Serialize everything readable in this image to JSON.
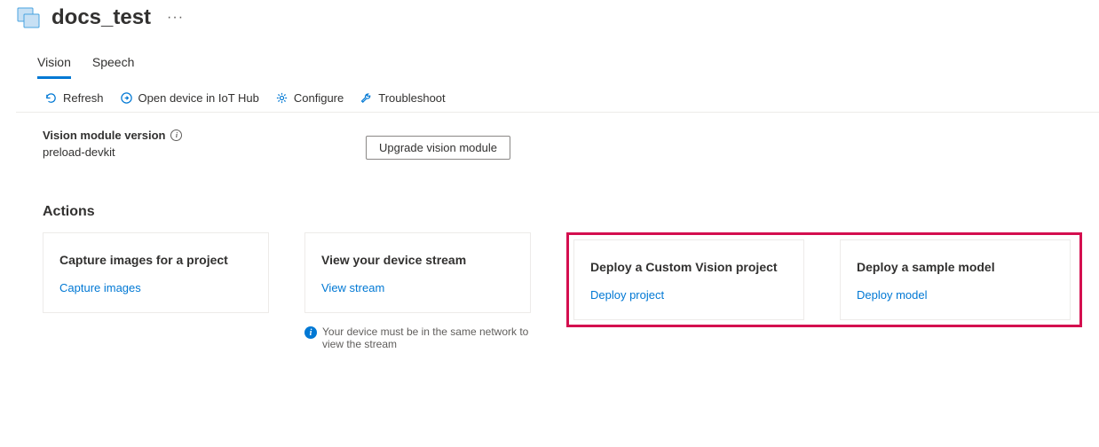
{
  "header": {
    "title": "docs_test",
    "more": "···"
  },
  "tabs": [
    {
      "id": "vision",
      "label": "Vision",
      "active": true
    },
    {
      "id": "speech",
      "label": "Speech",
      "active": false
    }
  ],
  "toolbar": {
    "refresh": "Refresh",
    "open_hub": "Open device in IoT Hub",
    "configure": "Configure",
    "troubleshoot": "Troubleshoot"
  },
  "module": {
    "label": "Vision module version",
    "value": "preload-devkit",
    "upgrade_btn": "Upgrade vision module"
  },
  "actions": {
    "title": "Actions",
    "cards": [
      {
        "title": "Capture images for a project",
        "link": "Capture images",
        "hint": null
      },
      {
        "title": "View your device stream",
        "link": "View stream",
        "hint": "Your device must be in the same network to view the stream"
      },
      {
        "title": "Deploy a Custom Vision project",
        "link": "Deploy project",
        "hint": null
      },
      {
        "title": "Deploy a sample model",
        "link": "Deploy model",
        "hint": null
      }
    ]
  }
}
